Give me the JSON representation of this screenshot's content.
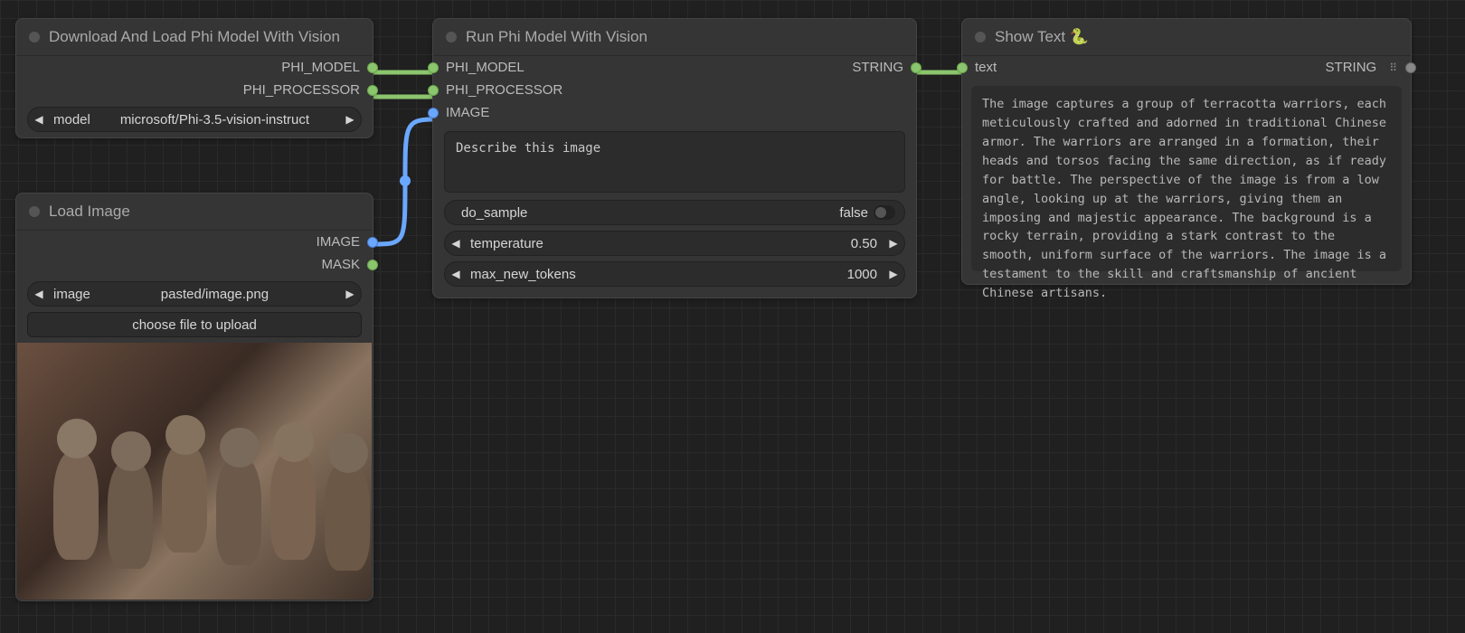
{
  "nodes": {
    "download_model": {
      "title": "Download And Load Phi Model With Vision",
      "outputs": {
        "model": "PHI_MODEL",
        "processor": "PHI_PROCESSOR"
      },
      "widget_model": {
        "label": "model",
        "value": "microsoft/Phi-3.5-vision-instruct"
      }
    },
    "load_image": {
      "title": "Load Image",
      "outputs": {
        "image": "IMAGE",
        "mask": "MASK"
      },
      "widget_image": {
        "label": "image",
        "value": "pasted/image.png"
      },
      "choose_file_label": "choose file to upload"
    },
    "run_model": {
      "title": "Run Phi Model With Vision",
      "inputs": {
        "model": "PHI_MODEL",
        "processor": "PHI_PROCESSOR",
        "image": "IMAGE"
      },
      "outputs": {
        "string": "STRING"
      },
      "prompt": "Describe this image",
      "do_sample": {
        "label": "do_sample",
        "value": "false"
      },
      "temperature": {
        "label": "temperature",
        "value": "0.50"
      },
      "max_new_tokens": {
        "label": "max_new_tokens",
        "value": "1000"
      }
    },
    "show_text": {
      "title": "Show Text",
      "snake": "🐍",
      "inputs": {
        "text": "text"
      },
      "outputs": {
        "string": "STRING"
      },
      "content": "The image captures a group of terracotta warriors, each meticulously crafted and adorned in traditional Chinese armor. The warriors are arranged in a formation, their heads and torsos facing the same direction, as if ready for battle. The perspective of the image is from a low angle, looking up at the warriors, giving them an imposing and majestic appearance. The background is a rocky terrain, providing a stark contrast to the smooth, uniform surface of the warriors. The image is a testament to the skill and craftsmanship of ancient Chinese artisans."
    }
  }
}
